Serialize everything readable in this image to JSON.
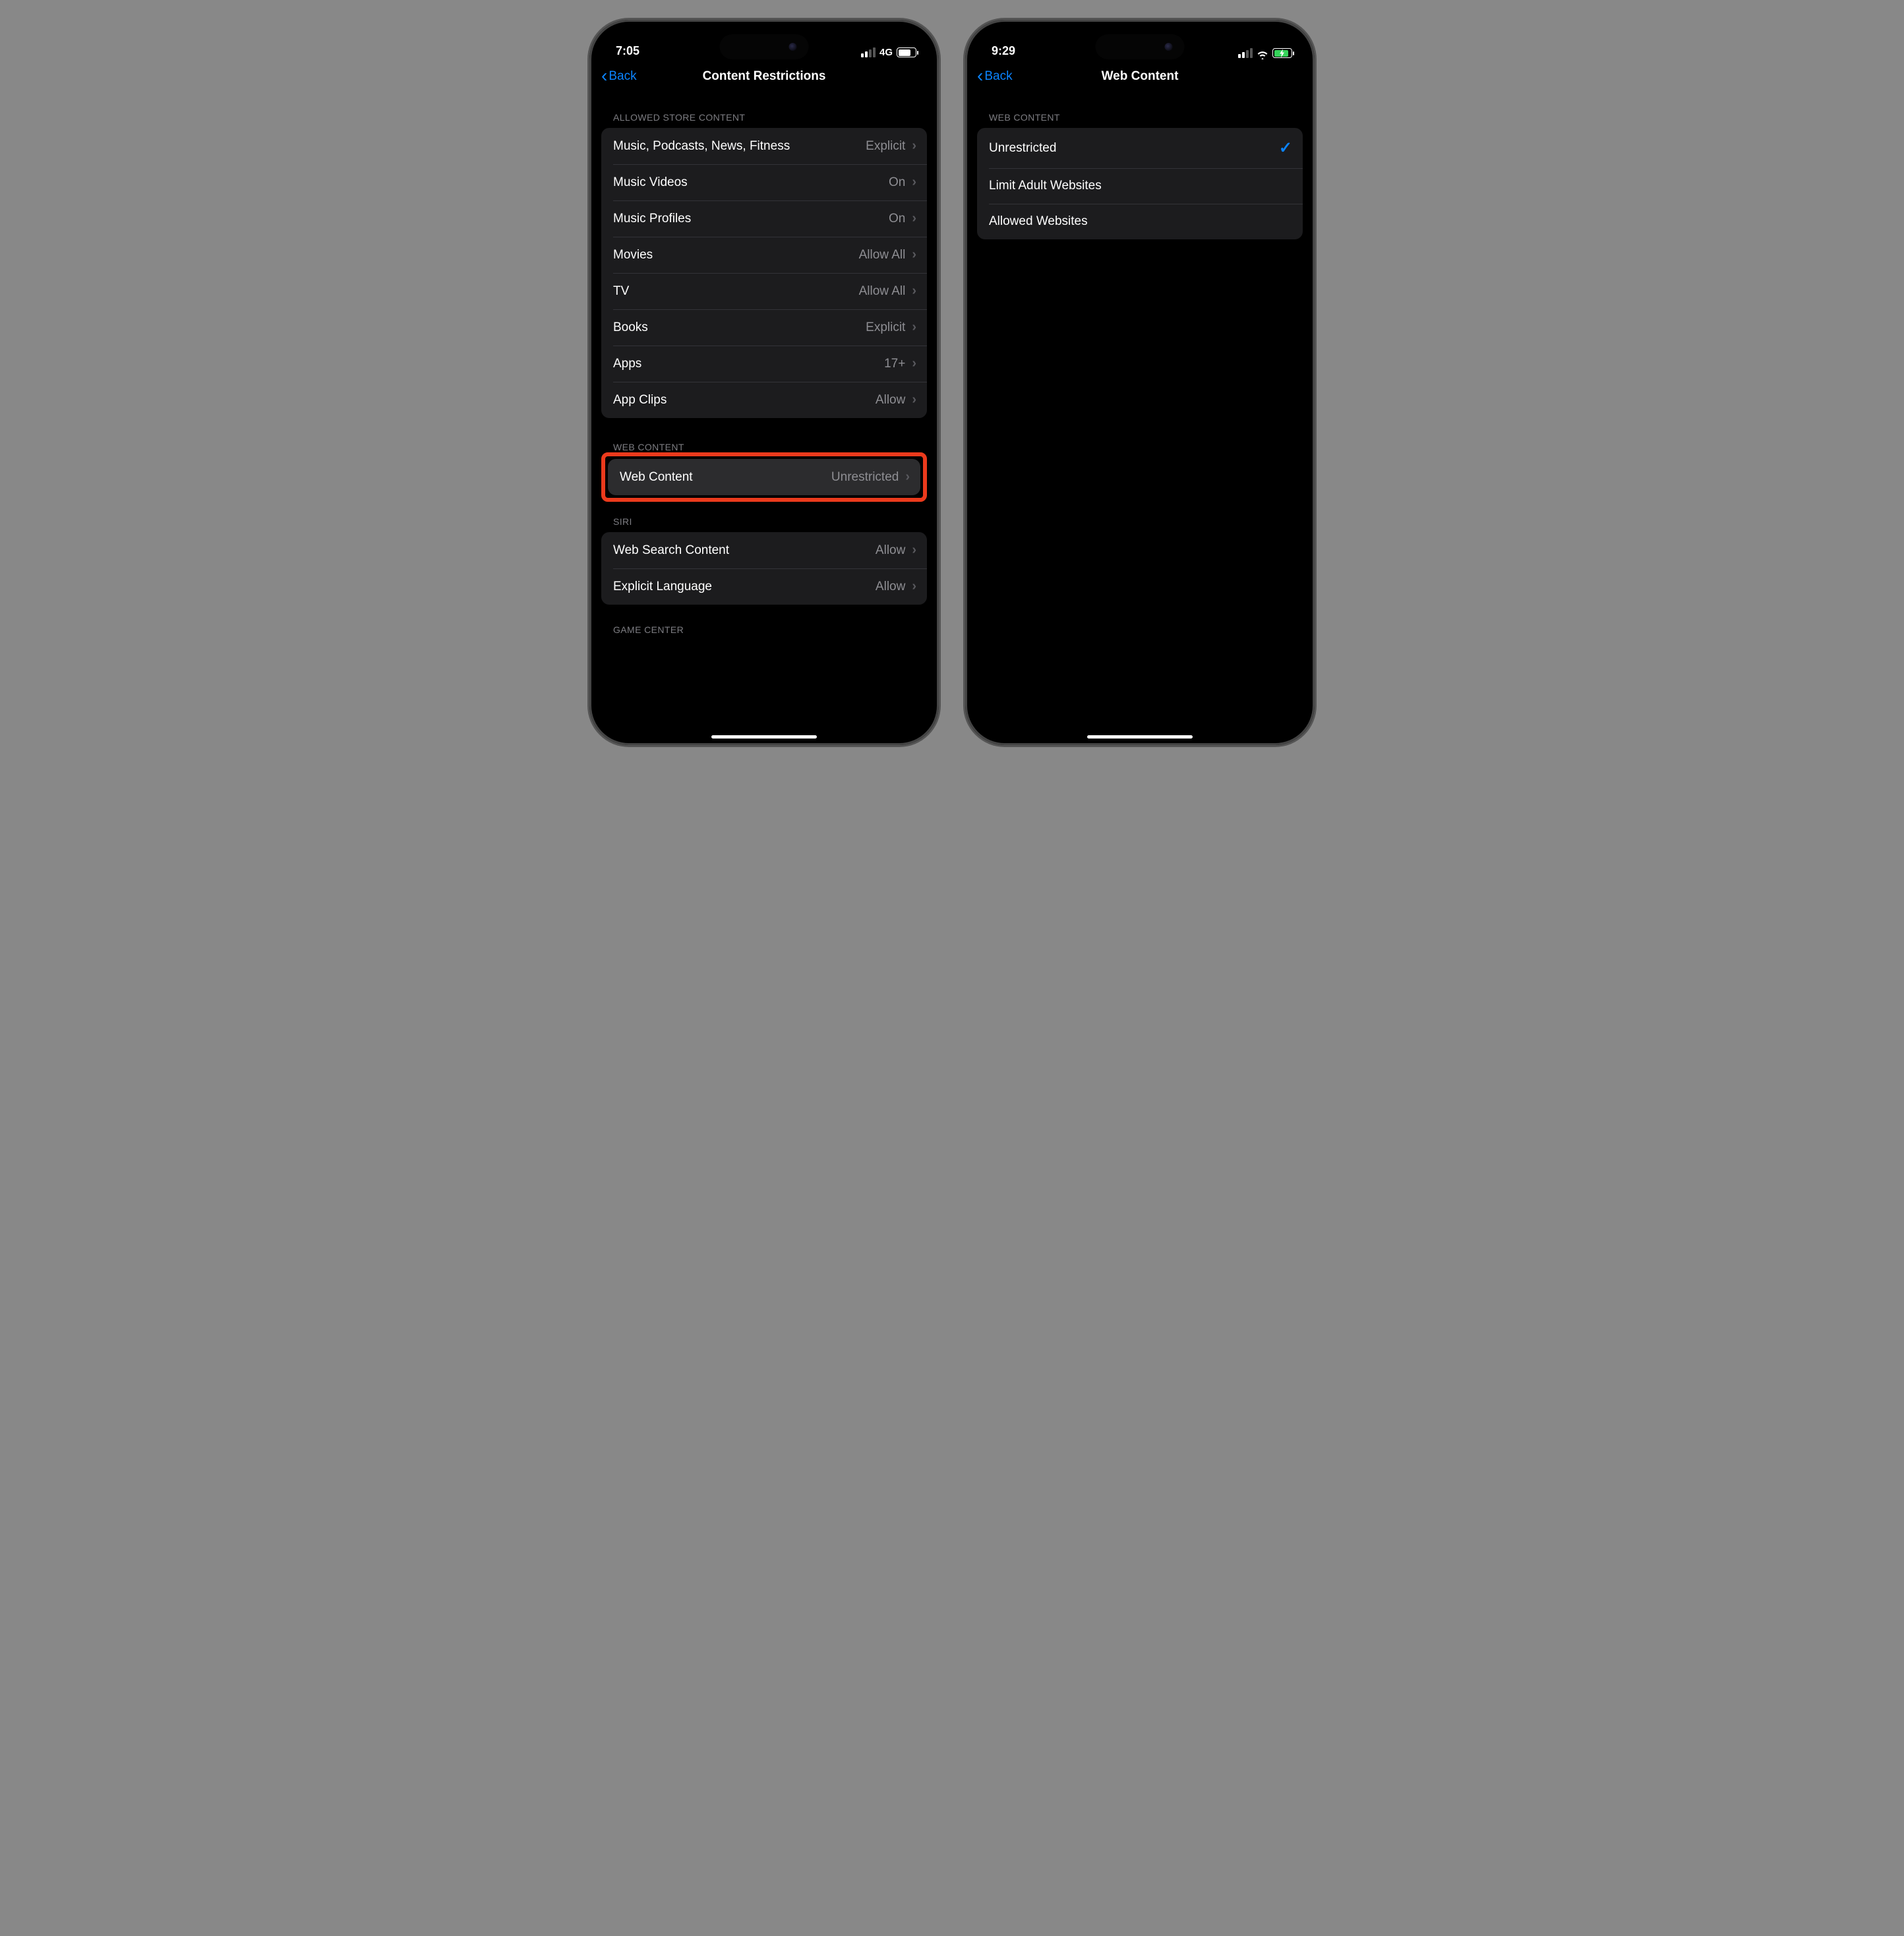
{
  "left": {
    "status": {
      "time": "7:05",
      "net": "4G"
    },
    "nav": {
      "back": "Back",
      "title": "Content Restrictions"
    },
    "sections": {
      "store_header": "ALLOWED STORE CONTENT",
      "store": [
        {
          "label": "Music, Podcasts, News, Fitness",
          "value": "Explicit"
        },
        {
          "label": "Music Videos",
          "value": "On"
        },
        {
          "label": "Music Profiles",
          "value": "On"
        },
        {
          "label": "Movies",
          "value": "Allow All"
        },
        {
          "label": "TV",
          "value": "Allow All"
        },
        {
          "label": "Books",
          "value": "Explicit"
        },
        {
          "label": "Apps",
          "value": "17+"
        },
        {
          "label": "App Clips",
          "value": "Allow"
        }
      ],
      "web_header": "WEB CONTENT",
      "web": {
        "label": "Web Content",
        "value": "Unrestricted"
      },
      "siri_header": "SIRI",
      "siri": [
        {
          "label": "Web Search Content",
          "value": "Allow"
        },
        {
          "label": "Explicit Language",
          "value": "Allow"
        }
      ],
      "gc_header": "GAME CENTER"
    }
  },
  "right": {
    "status": {
      "time": "9:29"
    },
    "nav": {
      "back": "Back",
      "title": "Web Content"
    },
    "sections": {
      "header": "WEB CONTENT",
      "options": [
        {
          "label": "Unrestricted",
          "selected": true
        },
        {
          "label": "Limit Adult Websites",
          "selected": false
        },
        {
          "label": "Allowed Websites",
          "selected": false
        }
      ]
    }
  }
}
